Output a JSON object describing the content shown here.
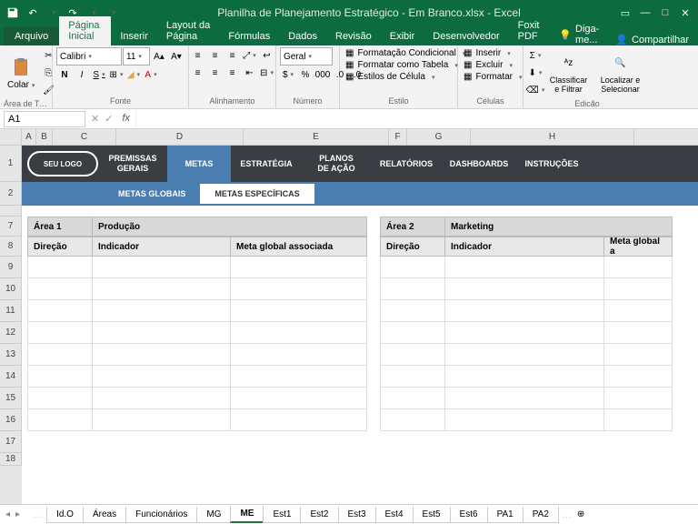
{
  "titlebar": {
    "title": "Planilha de Planejamento Estratégico - Em Branco.xlsx - Excel"
  },
  "tabs": {
    "file": "Arquivo",
    "home": "Página Inicial",
    "insert": "Inserir",
    "layout": "Layout da Página",
    "formulas": "Fórmulas",
    "data": "Dados",
    "review": "Revisão",
    "view": "Exibir",
    "developer": "Desenvolvedor",
    "foxit": "Foxit PDF",
    "tellme": "Diga-me...",
    "share": "Compartilhar"
  },
  "ribbon": {
    "clipboard": {
      "paste": "Colar",
      "label": "Área de Tra..."
    },
    "font": {
      "name": "Calibri",
      "size": "11",
      "label": "Fonte",
      "bold": "N",
      "italic": "I",
      "underline": "S"
    },
    "alignment": {
      "label": "Alinhamento"
    },
    "number": {
      "format": "Geral",
      "label": "Número"
    },
    "styles": {
      "conditional": "Formatação Condicional",
      "table": "Formatar como Tabela",
      "cell": "Estilos de Célula",
      "label": "Estilo"
    },
    "cells": {
      "insert": "Inserir",
      "delete": "Excluir",
      "format": "Formatar",
      "label": "Células"
    },
    "editing": {
      "sort": "Classificar e Filtrar",
      "find": "Localizar e Selecionar",
      "label": "Edição"
    }
  },
  "formulabar": {
    "namebox": "A1",
    "fx": "fx"
  },
  "columns": [
    "A",
    "B",
    "C",
    "D",
    "E",
    "F",
    "G",
    "H"
  ],
  "rows": [
    "1",
    "2",
    "7",
    "8",
    "9",
    "10",
    "11",
    "12",
    "13",
    "14",
    "15",
    "16",
    "17",
    "18"
  ],
  "nav": {
    "logo": "SEU LOGO",
    "items": [
      "PREMISSAS GERAIS",
      "METAS",
      "ESTRATÉGIA",
      "PLANOS DE AÇÃO",
      "RELATÓRIOS",
      "DASHBOARDS",
      "INSTRUÇÕES"
    ],
    "subtabs": {
      "global": "METAS GLOBAIS",
      "specific": "METAS ESPECÍFICAS"
    }
  },
  "tables": {
    "left": {
      "area_label": "Área 1",
      "area_value": "Produção",
      "col1": "Direção",
      "col2": "Indicador",
      "col3": "Meta global associada"
    },
    "right": {
      "area_label": "Área 2",
      "area_value": "Marketing",
      "col1": "Direção",
      "col2": "Indicador",
      "col3": "Meta global a"
    }
  },
  "sheets": [
    "Id.O",
    "Áreas",
    "Funcionários",
    "MG",
    "ME",
    "Est1",
    "Est2",
    "Est3",
    "Est4",
    "Est5",
    "Est6",
    "PA1",
    "PA2"
  ]
}
